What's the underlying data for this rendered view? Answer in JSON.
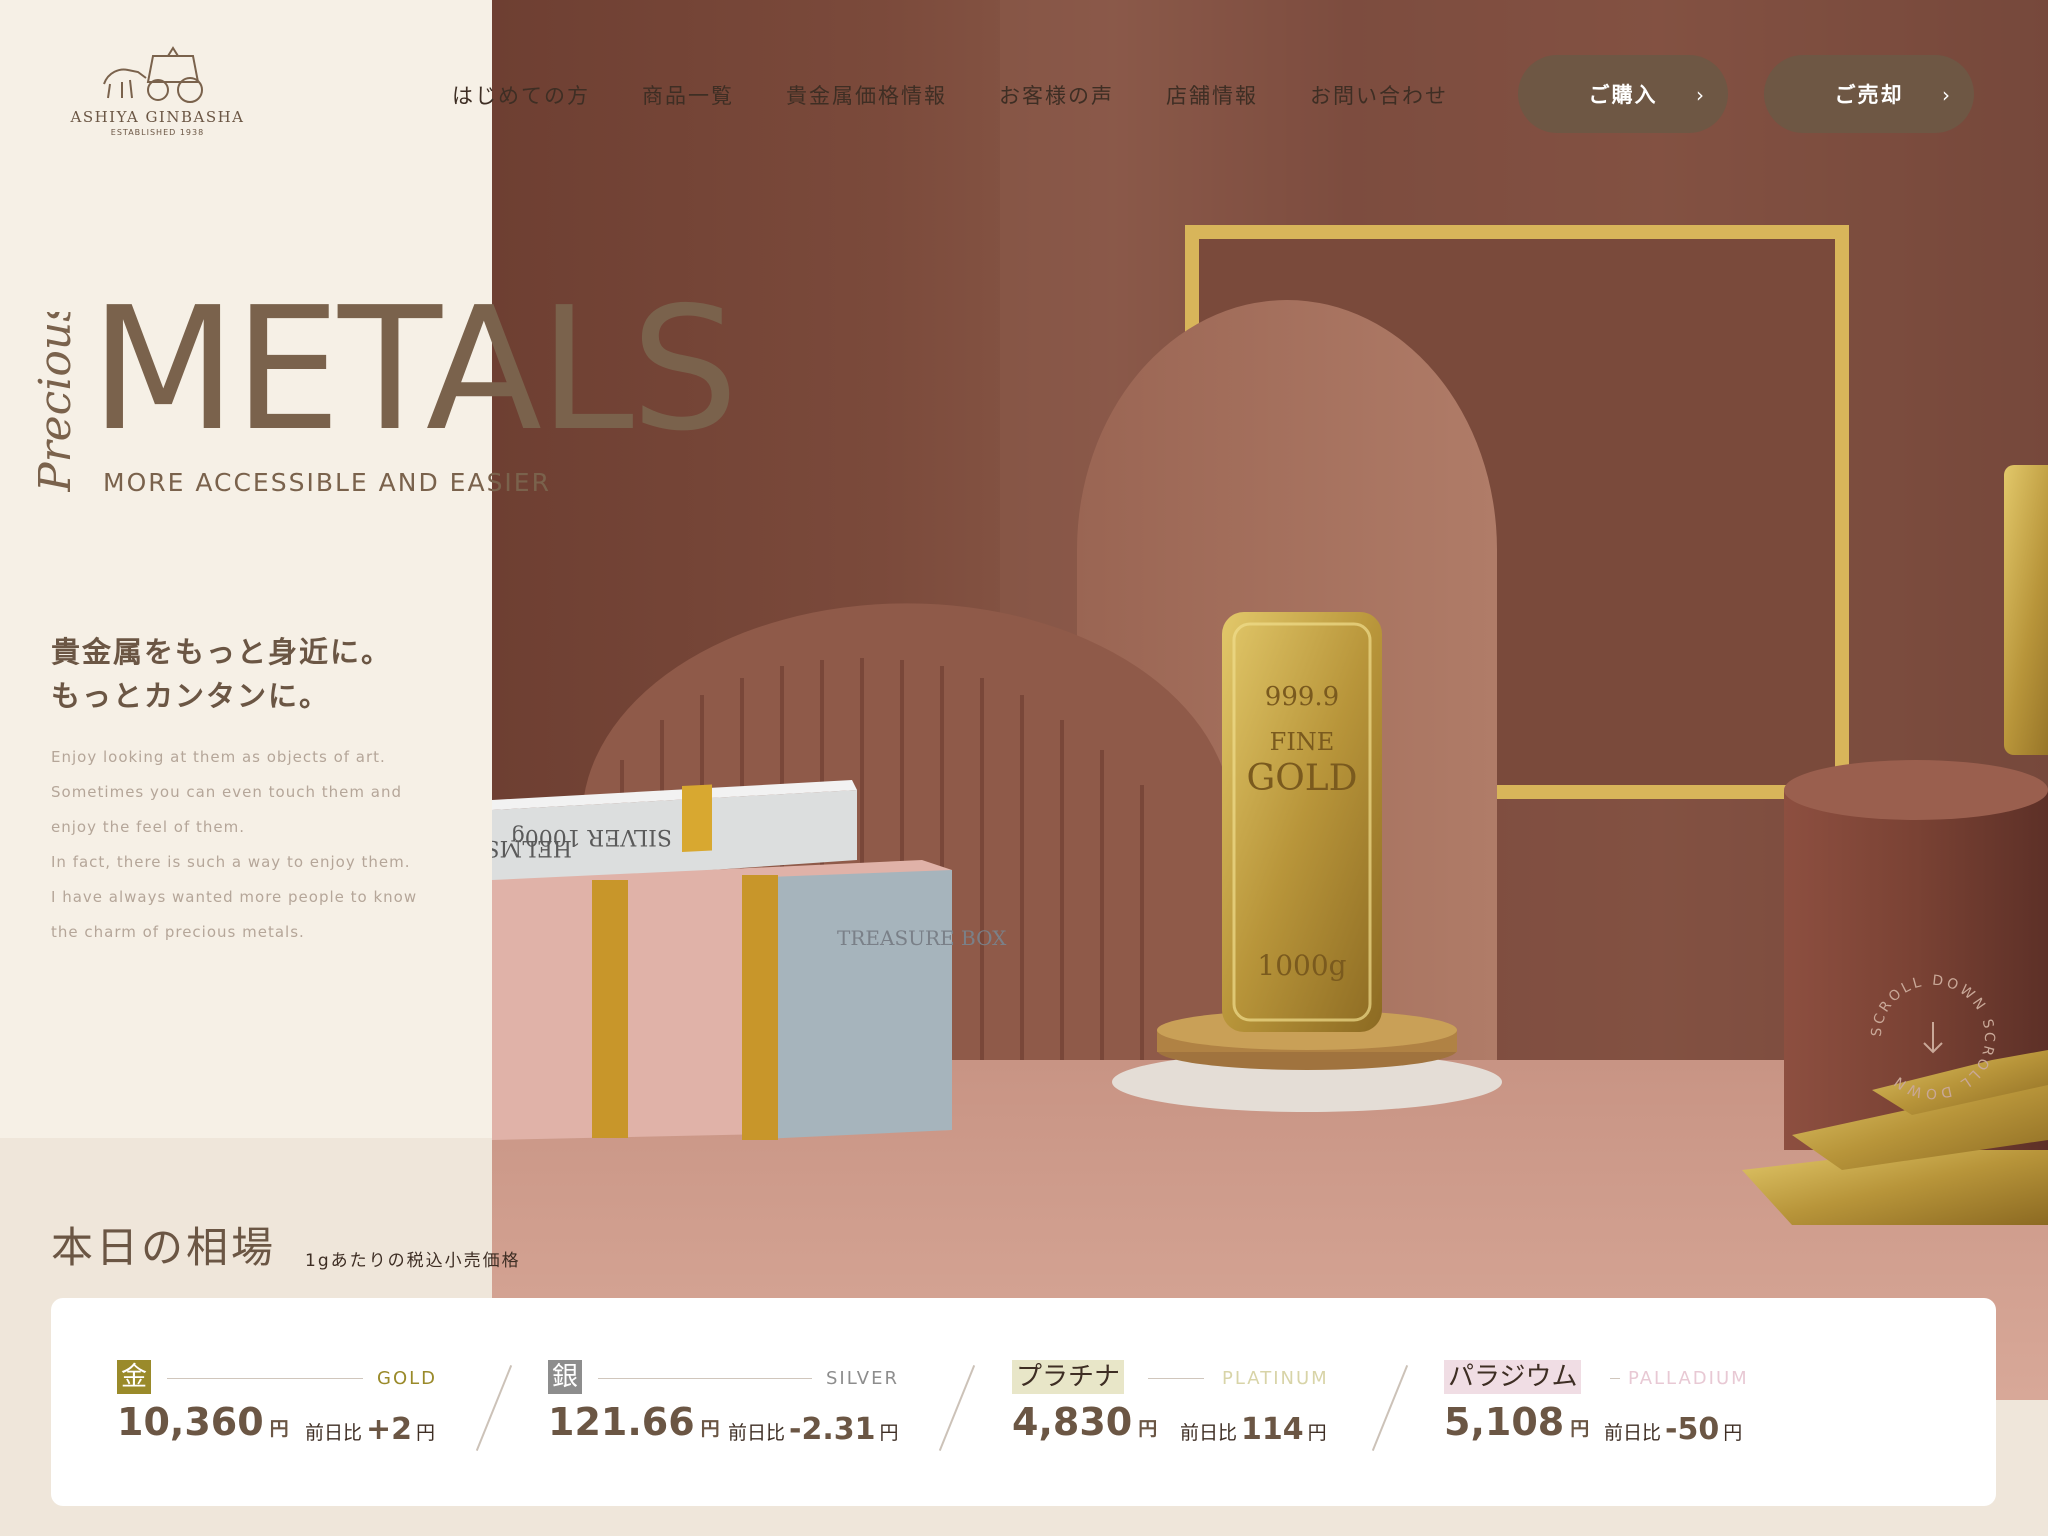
{
  "brand": {
    "name": "ASHIYA GINBASHA",
    "established": "ESTABLISHED 1938"
  },
  "nav": {
    "items": [
      "はじめての方",
      "商品一覧",
      "貴金属価格情報",
      "お客様の声",
      "店舗情報",
      "お問い合わせ"
    ],
    "buy_label": "ご購入",
    "sell_label": "ご売却"
  },
  "hero": {
    "script_word": "Precious",
    "headline": "METALS",
    "tagline": "MORE ACCESSIBLE AND EASIER",
    "lead_line1": "貴金属をもっと身近に。",
    "lead_line2": "もっとカンタンに。",
    "description": [
      "Enjoy looking at them as objects of art.",
      "Sometimes you can even touch them and",
      "enjoy the feel of them.",
      "In fact, there is such a way to enjoy them.",
      "I have always wanted more people to know",
      "the charm of precious metals."
    ],
    "scroll_label": "SCROLL DOWN SCROLL DOWN",
    "products": {
      "gold_bar_lines": [
        "999.9",
        "FINE",
        "GOLD",
        "1000g"
      ],
      "silver_bar_text": "SILVER 1000g",
      "silver_bar_brand": "HELMS",
      "box_text": "TREASURE BOX"
    }
  },
  "market": {
    "title": "本日の相場",
    "note": "1gあたりの税込小売価格",
    "compare_label": "前日比",
    "currency": "円",
    "metals": [
      {
        "badge": "金",
        "en": "GOLD",
        "price": "10,360",
        "delta": "+2",
        "badge_bg": "#9a8a2a",
        "badge_fg": "#ffffff",
        "en_color": "#9a8a2a"
      },
      {
        "badge": "銀",
        "en": "SILVER",
        "price": "121.66",
        "delta": "-2.31",
        "badge_bg": "#8d8d8d",
        "badge_fg": "#ffffff",
        "en_color": "#8d8d8d"
      },
      {
        "badge": "プラチナ",
        "en": "PLATINUM",
        "price": "4,830",
        "delta": "114",
        "badge_bg": "#e8e6c8",
        "badge_fg": "#3e2e24",
        "en_color": "#d8d4a8"
      },
      {
        "badge": "パラジウム",
        "en": "PALLADIUM",
        "price": "5,108",
        "delta": "-50",
        "badge_bg": "#f0dde4",
        "badge_fg": "#3e2e24",
        "en_color": "#e8c9d4"
      }
    ]
  },
  "colors": {
    "brand_brown": "#6e5744",
    "text_brown": "#6b5644",
    "cream": "#f6f0e6"
  }
}
